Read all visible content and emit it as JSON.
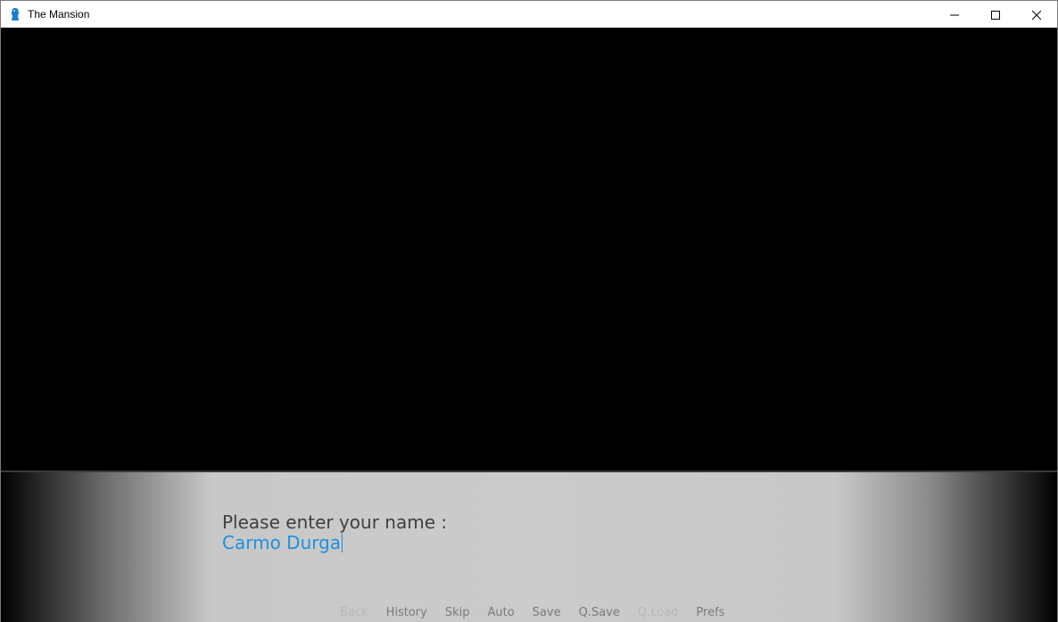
{
  "window": {
    "title": "The Mansion",
    "app_icon": "renpy-icon",
    "controls": [
      "minimize-icon",
      "maximize-icon",
      "close-icon"
    ]
  },
  "dialogue": {
    "prompt": "Please enter your name :",
    "input_value": "Carmo Durga"
  },
  "quick_menu": {
    "items": [
      {
        "label": "Back",
        "enabled": false
      },
      {
        "label": "History",
        "enabled": true
      },
      {
        "label": "Skip",
        "enabled": true
      },
      {
        "label": "Auto",
        "enabled": true
      },
      {
        "label": "Save",
        "enabled": true
      },
      {
        "label": "Q.Save",
        "enabled": true
      },
      {
        "label": "Q.Load",
        "enabled": false
      },
      {
        "label": "Prefs",
        "enabled": true
      }
    ]
  },
  "colors": {
    "input_text": "#1e90e0",
    "prompt_text": "#404040",
    "background": "#000000"
  }
}
